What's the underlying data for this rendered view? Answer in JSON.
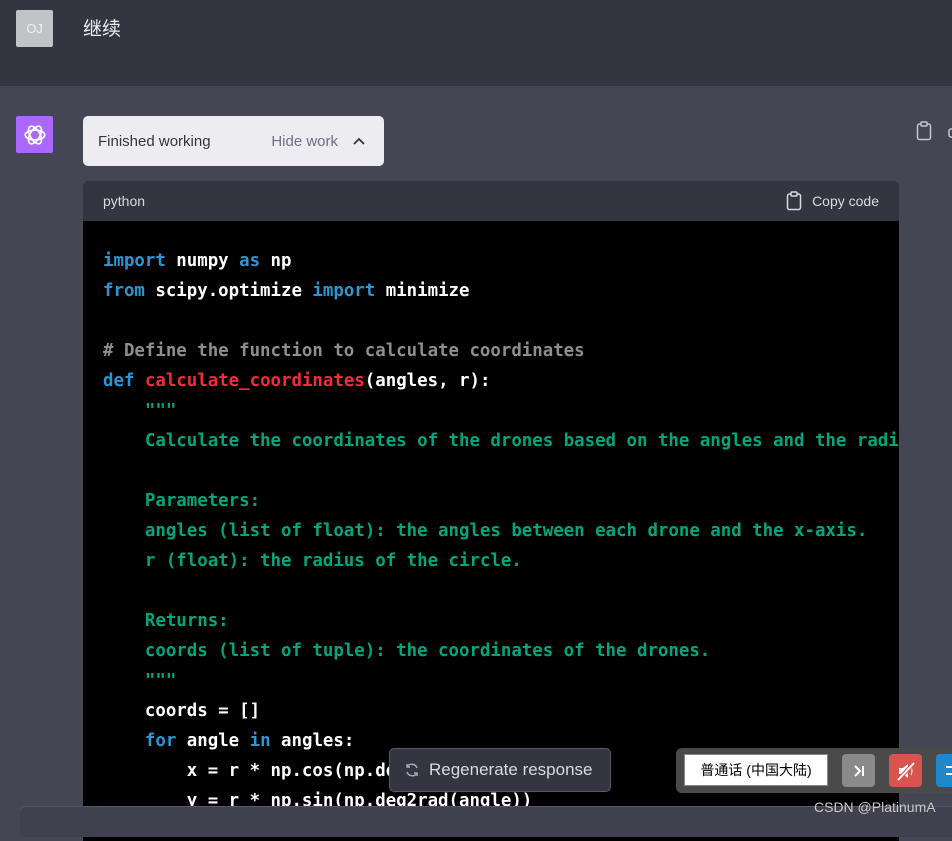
{
  "user": {
    "avatar_initials": "OJ",
    "message": "继续"
  },
  "assistant": {
    "work_status": "Finished working",
    "hide_work_label": "Hide work",
    "code_block": {
      "language": "python",
      "copy_label": "Copy code",
      "lines": [
        [
          [
            "kw",
            "import"
          ],
          [
            "tx",
            " numpy "
          ],
          [
            "kw",
            "as"
          ],
          [
            "tx",
            " np"
          ]
        ],
        [
          [
            "kw",
            "from"
          ],
          [
            "tx",
            " scipy.optimize "
          ],
          [
            "kw",
            "import"
          ],
          [
            "tx",
            " minimize"
          ]
        ],
        [],
        [
          [
            "cm",
            "# Define the function to calculate coordinates"
          ]
        ],
        [
          [
            "kw",
            "def"
          ],
          [
            "tx",
            " "
          ],
          [
            "fn",
            "calculate_coordinates"
          ],
          [
            "tx",
            "(angles, r):"
          ]
        ],
        [
          [
            "st",
            "    \"\"\""
          ]
        ],
        [
          [
            "st",
            "    Calculate the coordinates of the drones based on the angles and the radi"
          ]
        ],
        [],
        [
          [
            "st",
            "    Parameters:"
          ]
        ],
        [
          [
            "st",
            "    angles (list of float): the angles between each drone and the x-axis."
          ]
        ],
        [
          [
            "st",
            "    r (float): the radius of the circle."
          ]
        ],
        [],
        [
          [
            "st",
            "    Returns:"
          ]
        ],
        [
          [
            "st",
            "    coords (list of tuple): the coordinates of the drones."
          ]
        ],
        [
          [
            "st",
            "    \"\"\""
          ]
        ],
        [
          [
            "tx",
            "    coords = []"
          ]
        ],
        [
          [
            "tx",
            "    "
          ],
          [
            "kw",
            "for"
          ],
          [
            "tx",
            " angle "
          ],
          [
            "kw",
            "in"
          ],
          [
            "tx",
            " angles:"
          ]
        ],
        [
          [
            "tx",
            "        x = r * np.cos(np.deg2rad(angle))"
          ]
        ],
        [
          [
            "tx",
            "        y = r * np.sin(np.deg2rad(angle))"
          ]
        ]
      ]
    }
  },
  "regenerate_label": "Regenerate response",
  "voice_toolbar": {
    "language": "普通话 (中国大陆)"
  },
  "watermark": "CSDN @PlatinumA",
  "colors": {
    "keyword": "#2e95d3",
    "function": "#f22c3d",
    "comment": "#8e8e8e",
    "string": "#00a67d",
    "gpt_avatar": "#ab68ff"
  }
}
